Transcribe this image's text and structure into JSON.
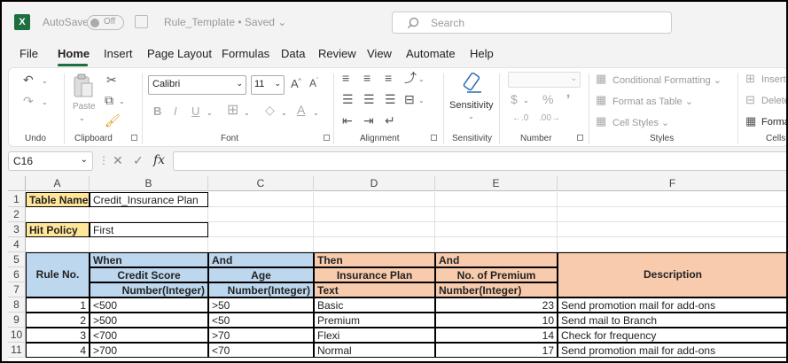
{
  "titlebar": {
    "app_logo": "X",
    "autosave_label": "AutoSave",
    "autosave_state": "Off",
    "document_title": "Rule_Template • Saved",
    "title_dropdown": "⌄",
    "search_placeholder": "Search"
  },
  "menu": [
    "File",
    "Home",
    "Insert",
    "Page Layout",
    "Formulas",
    "Data",
    "Review",
    "View",
    "Automate",
    "Help"
  ],
  "ribbon": {
    "undo_label": "Undo",
    "clipboard_label": "Clipboard",
    "paste_label": "Paste",
    "font_label": "Font",
    "font_name": "Calibri",
    "font_size": "11",
    "alignment_label": "Alignment",
    "sensitivity_label": "Sensitivity",
    "sensitivity_button": "Sensitivity",
    "number_label": "Number",
    "styles_label": "Styles",
    "conditional_formatting": "Conditional Formatting",
    "format_as_table": "Format as Table",
    "cell_styles": "Cell Styles",
    "cells_label": "Cells",
    "insert": "Insert",
    "delete": "Delete",
    "format": "Format"
  },
  "formula_bar": {
    "name_box": "C16",
    "fx": "fx",
    "formula": ""
  },
  "columns": [
    "A",
    "B",
    "C",
    "D",
    "E",
    "F"
  ],
  "rows": [
    "1",
    "2",
    "3",
    "4",
    "5",
    "6",
    "7",
    "8",
    "9",
    "10",
    "11"
  ],
  "sheet": {
    "table_name_label": "Table Name",
    "table_name_value": "Credit_Insurance Plan",
    "hit_policy_label": "Hit Policy",
    "hit_policy_value": "First",
    "rule_no": "Rule No.",
    "when": "When",
    "and1": "And",
    "then": "Then",
    "and2": "And",
    "description": "Description",
    "credit_score": "Credit Score",
    "age": "Age",
    "insurance_plan": "Insurance Plan",
    "no_of_premium": "No. of Premium",
    "type_b": "Number(Integer)",
    "type_c": "Number(Integer)",
    "type_d": "Text",
    "type_e": "Number(Integer)",
    "data": [
      {
        "rule": "1",
        "credit": "<500",
        "age": ">50",
        "plan": "Basic",
        "premium": "23",
        "desc": "Send promotion mail for add-ons"
      },
      {
        "rule": "2",
        "credit": ">500",
        "age": "<50",
        "plan": "Premium",
        "premium": "10",
        "desc": "Send mail to Branch"
      },
      {
        "rule": "3",
        "credit": "<700",
        "age": ">70",
        "plan": "Flexi",
        "premium": "14",
        "desc": "Check for frequency"
      },
      {
        "rule": "4",
        "credit": ">700",
        "age": "<70",
        "plan": "Normal",
        "premium": "17",
        "desc": "Send promotion mail for add-ons"
      }
    ]
  },
  "colors": {
    "excel_green": "#1d6f42",
    "label_yellow": "#ffe699",
    "condition_blue": "#bdd7ee",
    "action_orange": "#f8cbad"
  }
}
